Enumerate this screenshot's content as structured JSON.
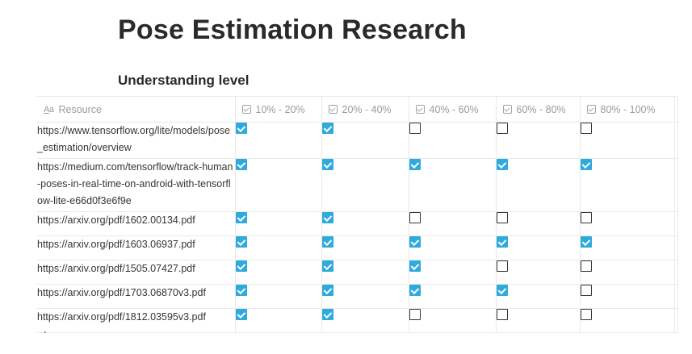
{
  "page": {
    "title": "Pose Estimation Research"
  },
  "view": {
    "title": "Understanding level"
  },
  "table": {
    "resource_header": {
      "icon": "text-property-icon",
      "label": "Resource"
    },
    "level_headers": [
      {
        "icon": "checkbox-property-icon",
        "label": "10% - 20%"
      },
      {
        "icon": "checkbox-property-icon",
        "label": "20% - 40%"
      },
      {
        "icon": "checkbox-property-icon",
        "label": "40% - 60%"
      },
      {
        "icon": "checkbox-property-icon",
        "label": "60% - 80%"
      },
      {
        "icon": "checkbox-property-icon",
        "label": "80% - 100%"
      }
    ],
    "rows": [
      {
        "resource": "https://www.tensorflow.org/lite/models/pose_estimation/overview",
        "checks": [
          true,
          true,
          false,
          false,
          false
        ]
      },
      {
        "resource": "https://medium.com/tensorflow/track-human-poses-in-real-time-on-android-with-tensorflow-lite-e66d0f3e6f9e",
        "checks": [
          true,
          true,
          true,
          true,
          true
        ]
      },
      {
        "resource": "https://arxiv.org/pdf/1602.00134.pdf",
        "checks": [
          true,
          true,
          false,
          false,
          false
        ]
      },
      {
        "resource": "https://arxiv.org/pdf/1603.06937.pdf",
        "checks": [
          true,
          true,
          true,
          true,
          true
        ]
      },
      {
        "resource": "https://arxiv.org/pdf/1505.07427.pdf",
        "checks": [
          true,
          true,
          true,
          false,
          false
        ]
      },
      {
        "resource": "https://arxiv.org/pdf/1703.06870v3.pdf",
        "checks": [
          true,
          true,
          true,
          true,
          false
        ]
      },
      {
        "resource": "https://arxiv.org/pdf/1812.03595v3.pdf",
        "checks": [
          true,
          true,
          false,
          false,
          false
        ]
      }
    ]
  },
  "colors": {
    "checked": "#2eaadc",
    "border": "#e9e9e7",
    "header_text": "#9b9a97",
    "text": "#37352f"
  }
}
